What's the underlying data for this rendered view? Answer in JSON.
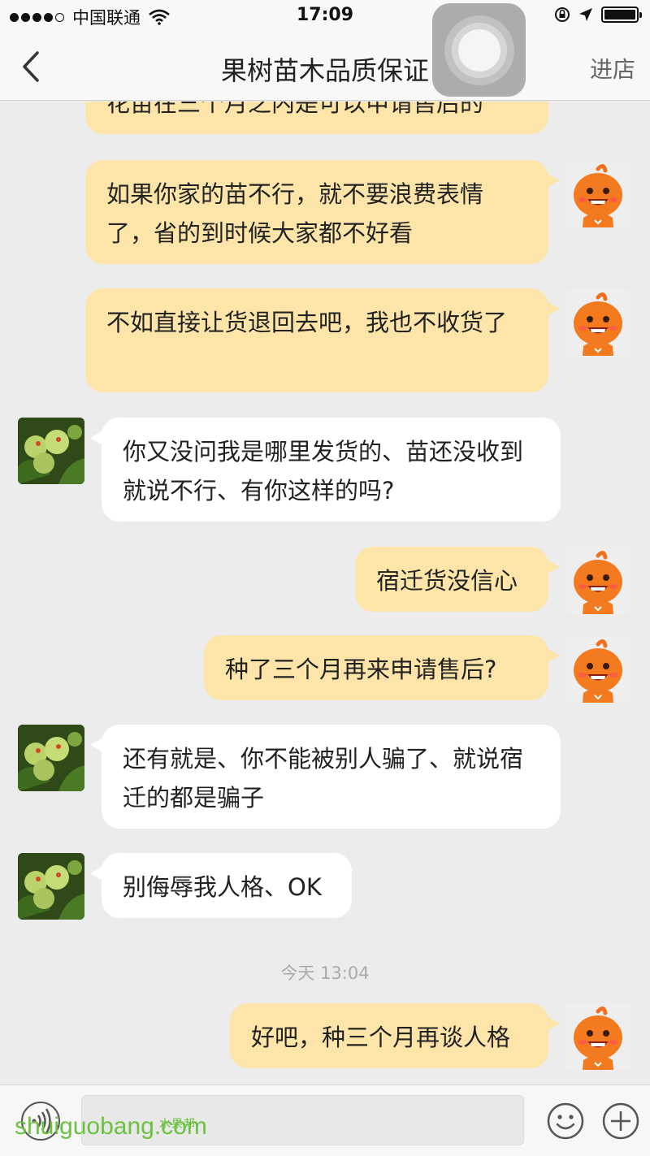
{
  "status_bar": {
    "carrier": "中国联通",
    "time": "17:09"
  },
  "header": {
    "title": "果树苗木品质保证",
    "store_label": "进店"
  },
  "messages": [
    {
      "sender": "me",
      "text": "花苗在三个月之内是可以申请售后的"
    },
    {
      "sender": "me",
      "text": "如果你家的苗不行，就不要浪费表情了，省的到时候大家都不好看"
    },
    {
      "sender": "me",
      "text": "不如直接让货退回去吧，我也不收货了"
    },
    {
      "sender": "them",
      "text": "你又没问我是哪里发货的、苗还没收到就说不行、有你这样的吗?"
    },
    {
      "sender": "me",
      "text": "宿迁货没信心"
    },
    {
      "sender": "me",
      "text": "种了三个月再来申请售后?"
    },
    {
      "sender": "them",
      "text": "还有就是、你不能被别人骗了、就说宿迁的都是骗子"
    },
    {
      "sender": "them",
      "text": "别侮辱我人格、OK"
    },
    {
      "sender": "me",
      "text": "好吧，种三个月再谈人格"
    }
  ],
  "timestamp": "今天 13:04",
  "watermark": {
    "text": "shuiguobang.com",
    "chinese": "水果邦"
  },
  "colors": {
    "my_bubble": "#fde5a9",
    "their_bubble": "#ffffff",
    "chat_background": "#ececec",
    "watermark": "#6cc13f"
  },
  "icons": {
    "back": "chevron-left-icon",
    "voice": "voice-icon",
    "emoji": "smiley-icon",
    "more": "plus-icon",
    "my_avatar": "orange-mascot",
    "their_avatar": "fruit-photo"
  }
}
